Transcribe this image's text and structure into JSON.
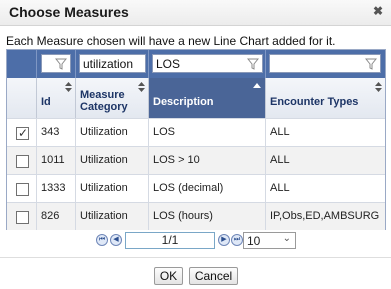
{
  "dialog": {
    "title": "Choose Measures"
  },
  "instruction": "Each Measure chosen will have a new Line Chart added for it.",
  "filters": {
    "category": "utilization",
    "description": "LOS",
    "encounter": ""
  },
  "columns": {
    "id": "Id",
    "category": "Measure Category",
    "description": "Description",
    "encounter": "Encounter Types"
  },
  "rows": [
    {
      "checked": true,
      "id": "343",
      "category": "Utilization",
      "description": "LOS",
      "encounter": "ALL"
    },
    {
      "checked": false,
      "id": "1011",
      "category": "Utilization",
      "description": "LOS > 10",
      "encounter": "ALL"
    },
    {
      "checked": false,
      "id": "1333",
      "category": "Utilization",
      "description": "LOS (decimal)",
      "encounter": "ALL"
    },
    {
      "checked": false,
      "id": "826",
      "category": "Utilization",
      "description": "LOS (hours)",
      "encounter": "IP,Obs,ED,AMBSURG"
    }
  ],
  "pager": {
    "page": "1/1",
    "page_size": "10"
  },
  "buttons": {
    "ok": "OK",
    "cancel": "Cancel"
  },
  "colors": {
    "header_blue": "#4d6ea8",
    "sorted_header": "#4a6597"
  }
}
